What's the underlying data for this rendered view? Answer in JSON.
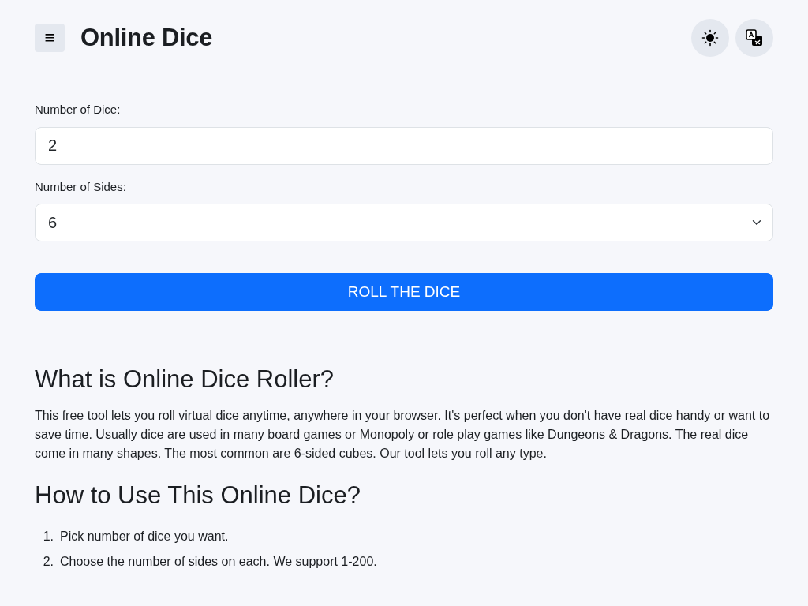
{
  "header": {
    "menu_glyph": "≡",
    "title": "Online Dice"
  },
  "form": {
    "dice_label": "Number of Dice:",
    "dice_value": "2",
    "sides_label": "Number of Sides:",
    "sides_value": "6",
    "button": "ROLL THE DICE"
  },
  "sections": [
    {
      "heading": "What is Online Dice Roller?",
      "paragraph": "This free tool lets you roll virtual dice anytime, anywhere in your browser. It's perfect when you don't have real dice handy or want to save time. Usually dice are used in many board games or Monopoly or role play games like Dungeons & Dragons. The real dice come in many shapes. The most common are 6-sided cubes. Our tool lets you roll any type."
    },
    {
      "heading": "How to Use This Online Dice?",
      "steps": [
        {
          "number": "1.",
          "text": "Pick number of dice you want."
        },
        {
          "number": "2.",
          "text": "Choose the number of sides on each. We support 1-200."
        }
      ]
    }
  ]
}
